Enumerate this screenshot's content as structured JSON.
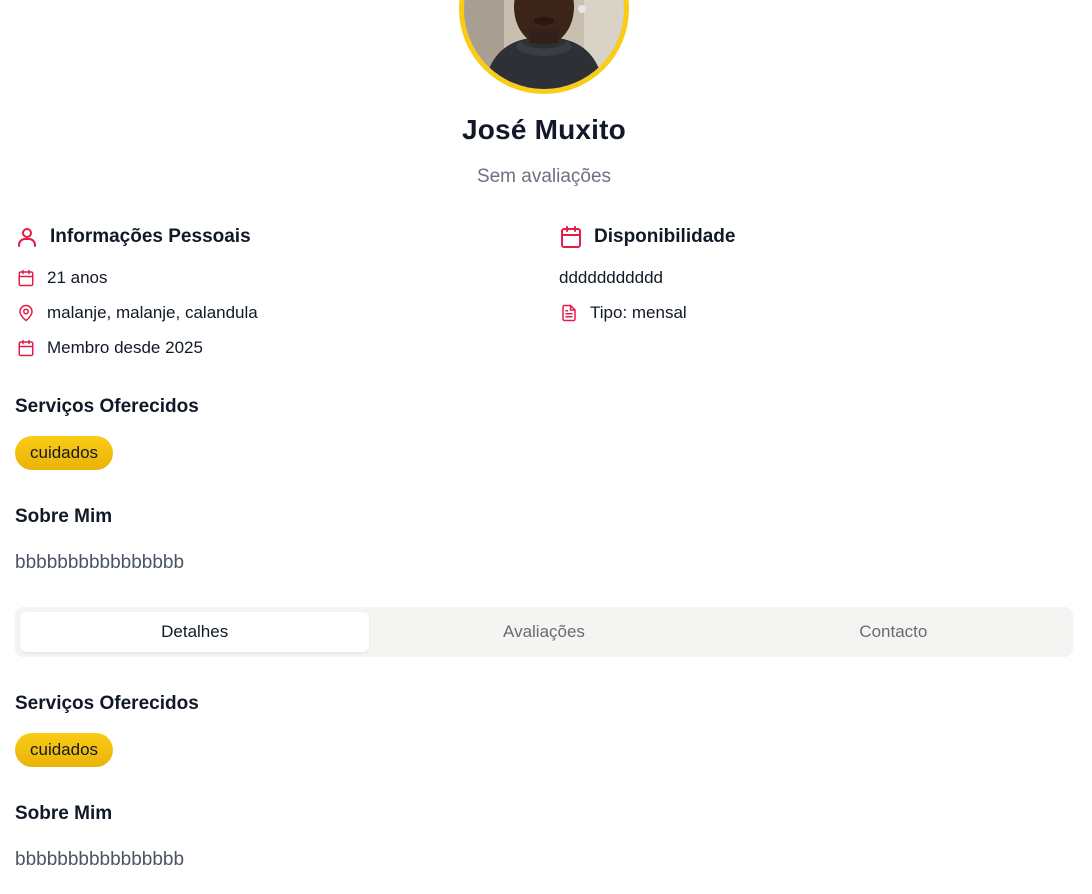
{
  "profile": {
    "name": "José Muxito",
    "rating_text": "Sem avaliações"
  },
  "personal_info": {
    "title": "Informações Pessoais",
    "age": "21 anos",
    "location": "malanje, malanje, calandula",
    "member_since": "Membro desde 2025"
  },
  "availability": {
    "title": "Disponibilidade",
    "value": "ddddddddddd",
    "type": "Tipo: mensal"
  },
  "services": {
    "title": "Serviços Oferecidos",
    "items": [
      "cuidados"
    ]
  },
  "about": {
    "title": "Sobre Mim",
    "text": "bbbbbbbbbbbbbbbb"
  },
  "tabs": [
    {
      "label": "Detalhes",
      "active": true
    },
    {
      "label": "Avaliações",
      "active": false
    },
    {
      "label": "Contacto",
      "active": false
    }
  ],
  "details_tab": {
    "services_title": "Serviços Oferecidos",
    "services": [
      "cuidados"
    ],
    "about_title": "Sobre Mim",
    "about_text": "bbbbbbbbbbbbbbbb"
  },
  "colors": {
    "accent": "#e11d48",
    "chip": "#facc15",
    "avatar_ring": "#facc15"
  },
  "icons": {
    "personal_info": "user-icon",
    "age": "calendar-icon",
    "location": "map-pin-icon",
    "member_since": "calendar-icon",
    "availability": "calendar-icon",
    "type": "file-text-icon"
  }
}
